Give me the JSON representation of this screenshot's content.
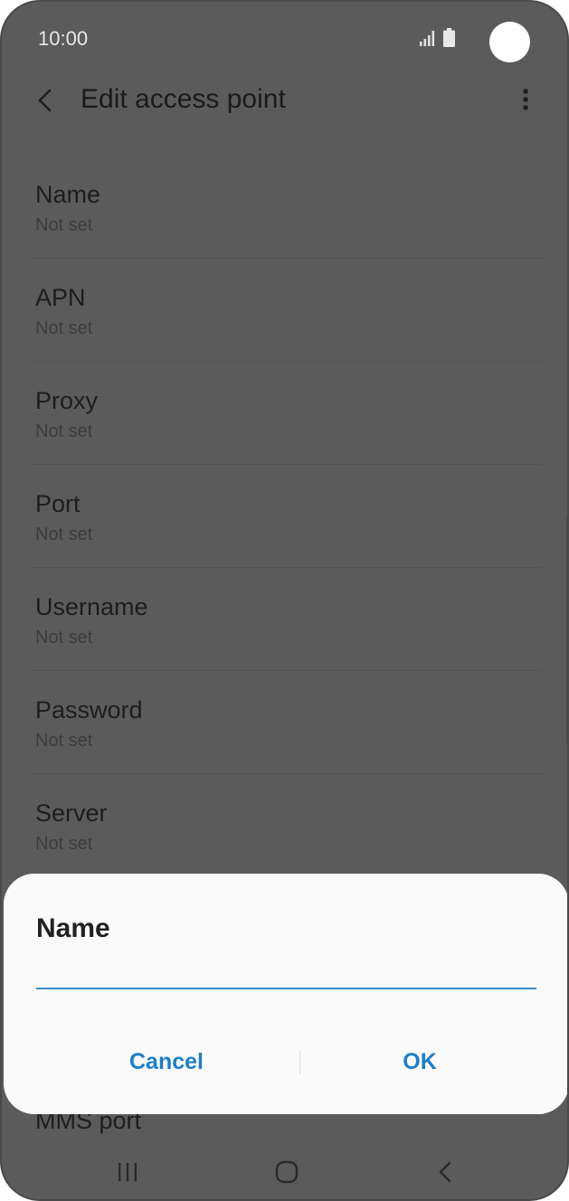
{
  "status_bar": {
    "time": "10:00",
    "icons": [
      "signal-icon",
      "battery-icon"
    ]
  },
  "app_bar": {
    "title": "Edit access point",
    "back_icon": "back-icon",
    "more_icon": "more-options-icon"
  },
  "settings": {
    "items": [
      {
        "title": "Name",
        "value": "Not set"
      },
      {
        "title": "APN",
        "value": "Not set"
      },
      {
        "title": "Proxy",
        "value": "Not set"
      },
      {
        "title": "Port",
        "value": "Not set"
      },
      {
        "title": "Username",
        "value": "Not set"
      },
      {
        "title": "Password",
        "value": "Not set"
      },
      {
        "title": "Server",
        "value": "Not set"
      }
    ],
    "partially_visible": "MMS port"
  },
  "dialog": {
    "title": "Name",
    "input_value": "",
    "cancel_label": "Cancel",
    "ok_label": "OK"
  },
  "nav_bar": {
    "icons": [
      "recents-icon",
      "home-icon",
      "back-icon"
    ]
  },
  "colors": {
    "accent": "#1e7ec8",
    "input_underline": "#3b8fc7",
    "dim_overlay": "#5b5b5b",
    "dialog_bg": "#fafafa"
  }
}
